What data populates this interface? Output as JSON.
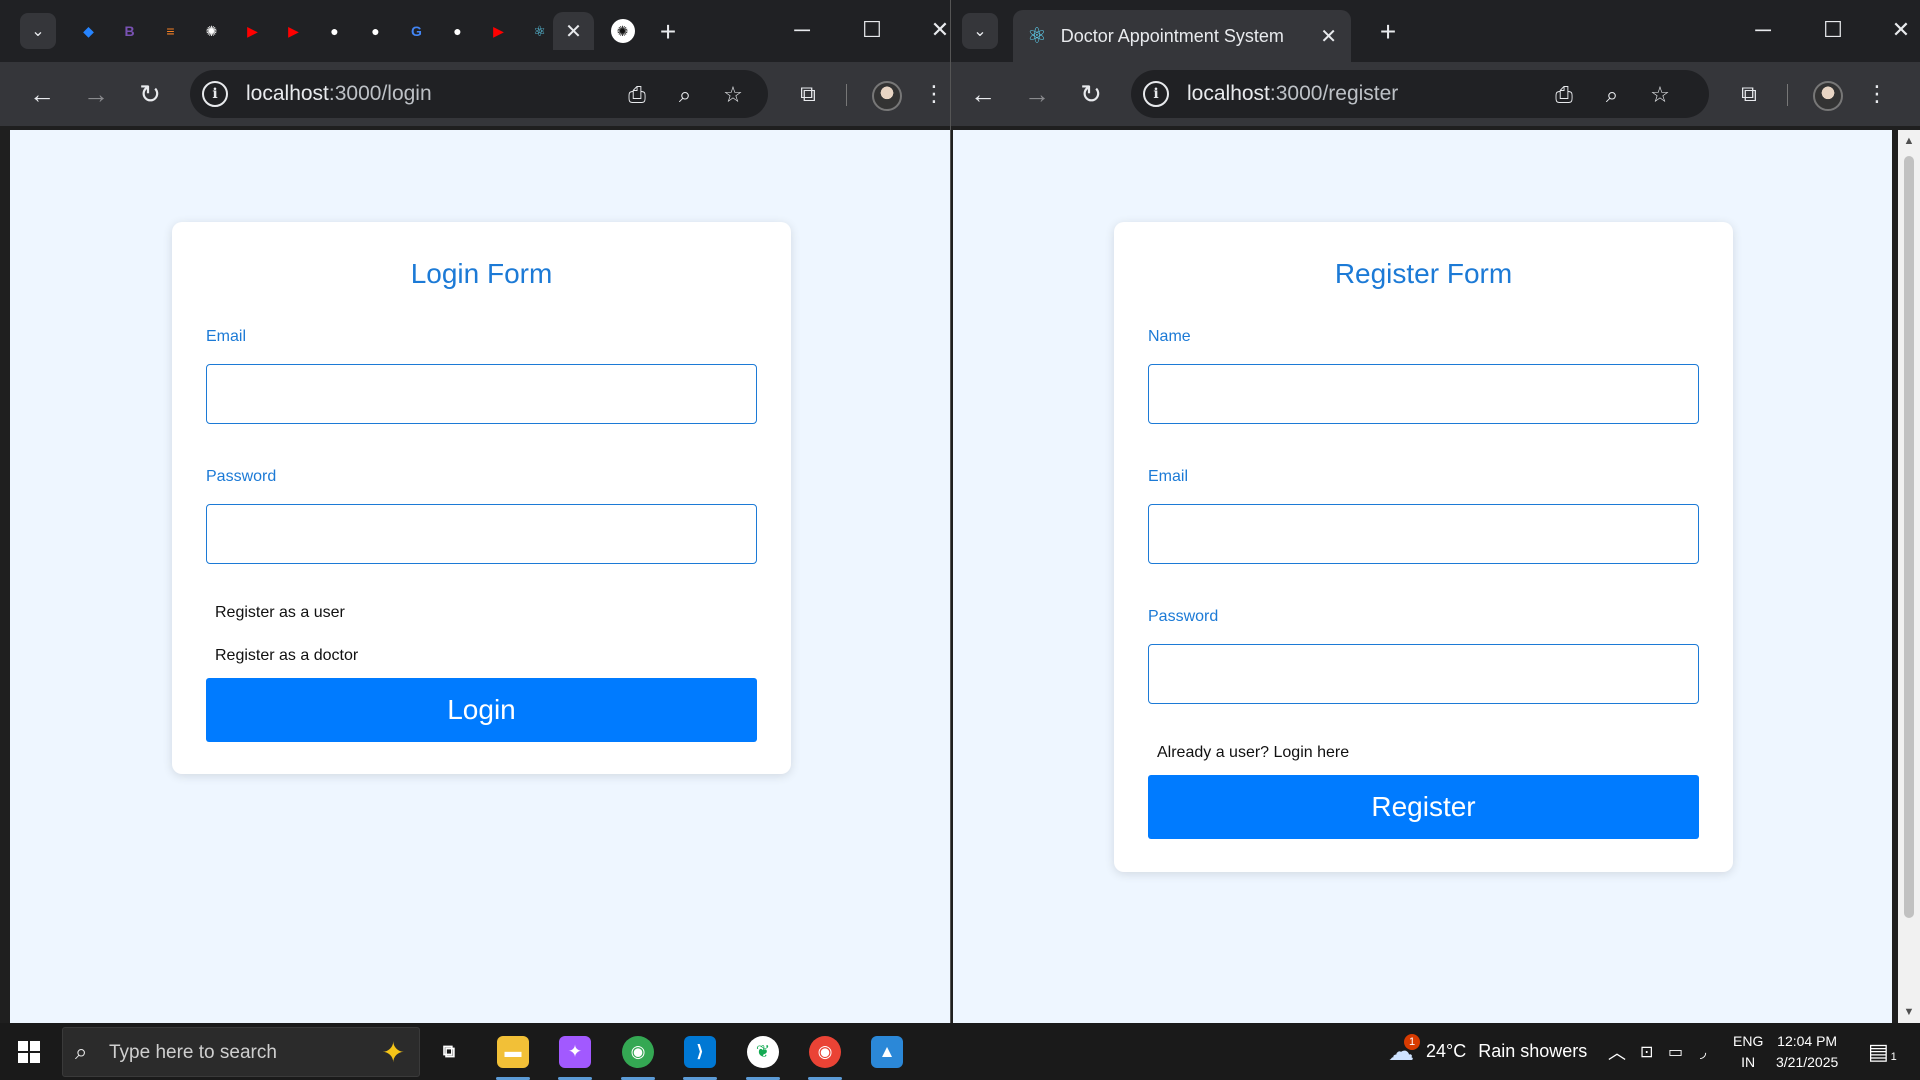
{
  "left_window": {
    "tab_search_icon": "chevron-down-icon",
    "pinned_tabs": [
      {
        "icon": "jira-icon",
        "color": "#2684ff",
        "glyph": "◆"
      },
      {
        "icon": "bootstrap-icon",
        "color": "#7952b3",
        "glyph": "B"
      },
      {
        "icon": "stackoverflow-icon",
        "color": "#f48024",
        "glyph": "≡"
      },
      {
        "icon": "chatgpt-icon",
        "color": "#ffffff",
        "glyph": "✺"
      },
      {
        "icon": "youtube-icon",
        "color": "#ff0000",
        "glyph": "▶"
      },
      {
        "icon": "youtube-icon",
        "color": "#ff0000",
        "glyph": "▶"
      },
      {
        "icon": "github-icon",
        "color": "#ffffff",
        "glyph": "●"
      },
      {
        "icon": "github-icon",
        "color": "#ffffff",
        "glyph": "●"
      },
      {
        "icon": "google-icon",
        "color": "#4285f4",
        "glyph": "G"
      },
      {
        "icon": "github-icon",
        "color": "#ffffff",
        "glyph": "●"
      },
      {
        "icon": "youtube-icon",
        "color": "#ff0000",
        "glyph": "▶"
      },
      {
        "icon": "react-icon",
        "color": "#61dafb",
        "glyph": "⚛"
      }
    ],
    "active_tab_close": "✕",
    "extra_tab_icon": "chatgpt-icon",
    "new_tab": "+",
    "url_host": "localhost",
    "url_path": ":3000/login",
    "page": {
      "title": "Login Form",
      "email_label": "Email",
      "email_value": "",
      "password_label": "Password",
      "password_value": "",
      "link_user": "Register as a user",
      "link_doctor": "Register as a doctor",
      "submit": "Login"
    }
  },
  "right_window": {
    "tab_title": "Doctor Appointment System",
    "tab_icon": "react-icon",
    "tab_close": "✕",
    "new_tab": "+",
    "url_host": "localhost",
    "url_path": ":3000/register",
    "page": {
      "title": "Register Form",
      "name_label": "Name",
      "name_value": "",
      "email_label": "Email",
      "email_value": "",
      "password_label": "Password",
      "password_value": "",
      "login_link": "Already a user? Login here",
      "submit": "Register"
    }
  },
  "window_controls": {
    "minimize": "─",
    "maximize": "☐",
    "close": "✕"
  },
  "taskbar": {
    "search_placeholder": "Type here to search",
    "apps": [
      {
        "name": "task-view-icon",
        "glyph": "⧉",
        "color": "#1a1a1a"
      },
      {
        "name": "file-explorer-icon",
        "glyph": "▬",
        "color": "#f2c037"
      },
      {
        "name": "copilot-icon",
        "glyph": "✦",
        "color": "#a259ff"
      },
      {
        "name": "chrome-icon",
        "glyph": "◉",
        "color": "#34a853"
      },
      {
        "name": "vscode-icon",
        "glyph": "⟩",
        "color": "#0078d4"
      },
      {
        "name": "mongodb-icon",
        "glyph": "❦",
        "color": "#ffffff"
      },
      {
        "name": "chrome-icon",
        "glyph": "◉",
        "color": "#ea4335"
      },
      {
        "name": "photos-icon",
        "glyph": "▲",
        "color": "#2b88d8"
      }
    ],
    "weather_badge": "1",
    "weather_temp": "24°C",
    "weather_desc": "Rain showers",
    "language_top": "ENG",
    "language_bottom": "IN",
    "time": "12:04 PM",
    "date": "3/21/2025",
    "notification_count": "1"
  },
  "colors": {
    "accent": "#1c7ad6",
    "button": "#007bff",
    "page_bg": "#eef6ff"
  }
}
